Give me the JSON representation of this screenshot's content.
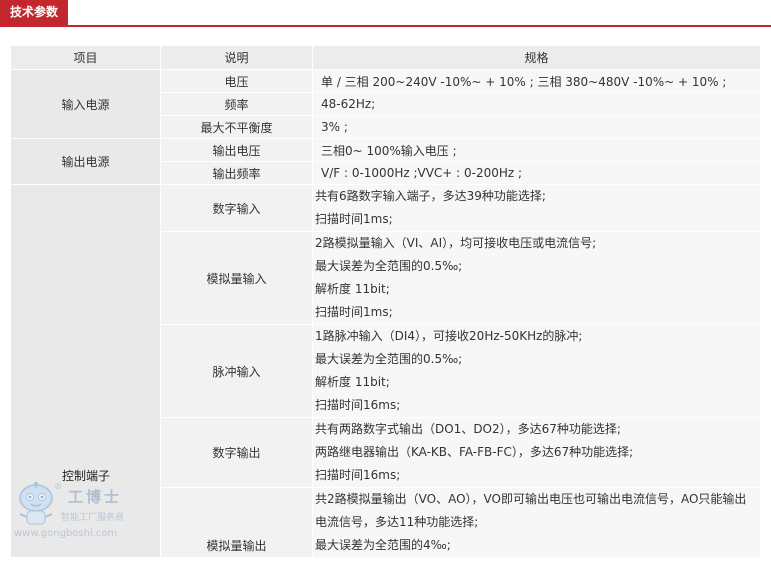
{
  "header": {
    "title": "技术参数"
  },
  "table": {
    "columns": [
      "项目",
      "说明",
      "规格"
    ],
    "input_power": {
      "group": "输入电源",
      "rows": [
        {
          "desc": "电压",
          "spec": "单 / 三相 200~240V -10%~ + 10% ; 三相 380~480V -10%~ + 10% ;"
        },
        {
          "desc": "频率",
          "spec": "48-62Hz;"
        },
        {
          "desc": "最大不平衡度",
          "spec": "3% ;"
        }
      ]
    },
    "output_power": {
      "group": "输出电源",
      "rows": [
        {
          "desc": "输出电压",
          "spec": "三相0~ 100%输入电压 ;"
        },
        {
          "desc": "输出频率",
          "spec": "V/F : 0-1000Hz ;VVC+ : 0-200Hz ;"
        }
      ]
    },
    "control_terminal": {
      "group": "控制端子",
      "rows": [
        {
          "desc": "数字输入",
          "lines": [
            "共有6路数字输入端子，多达39种功能选择;",
            "扫描时间1ms;"
          ]
        },
        {
          "desc": "模拟量输入",
          "lines": [
            "2路模拟量输入（VI、AI），均可接收电压或电流信号;",
            "最大误差为全范围的0.5‰;",
            "解析度 11bit;",
            "扫描时间1ms;"
          ]
        },
        {
          "desc": "脉冲输入",
          "lines": [
            "1路脉冲输入（DI4），可接收20Hz-50KHz的脉冲;",
            "最大误差为全范围的0.5‰;",
            "解析度 11bit;",
            "扫描时间16ms;"
          ]
        },
        {
          "desc": "数字输出",
          "lines": [
            "共有两路数字式输出（DO1、DO2），多达67种功能选择;",
            "两路继电器输出（KA-KB、FA-FB-FC），多达67种功能选择;",
            "扫描时间16ms;"
          ]
        },
        {
          "desc": "模拟量输出",
          "lines": [
            "共2路模拟量输出（VO、AO），VO即可输出电压也可输出电流信号，AO只能输出",
            "电流信号，多达11种功能选择;",
            "最大误差为全范围的4‰;"
          ]
        }
      ]
    }
  },
  "watermark": {
    "name": "工博士",
    "slogan": "智能工厂服务商",
    "url": "www.gongboshi.com",
    "reg": "®"
  }
}
